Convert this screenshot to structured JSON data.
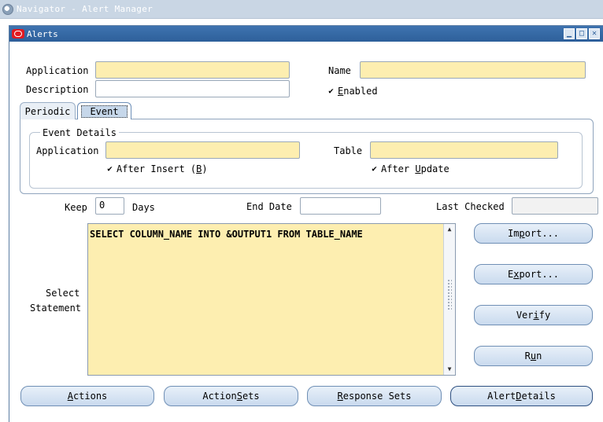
{
  "navigator": {
    "title": "Navigator - Alert Manager"
  },
  "window": {
    "title": "Alerts",
    "controls": {
      "minimize": "▁",
      "maximize": "□",
      "close": "✕"
    }
  },
  "form": {
    "application_label": "Application",
    "application_value": "",
    "name_label": "Name",
    "name_value": "",
    "description_label": "Description",
    "description_value": "",
    "enabled_label_pre": "",
    "enabled_hotkey": "E",
    "enabled_label_post": "nabled",
    "enabled_checked": "✔"
  },
  "tabs": [
    {
      "label": "Periodic"
    },
    {
      "label": "Event"
    }
  ],
  "event_details": {
    "legend": "Event Details",
    "application_label": "Application",
    "application_value": "",
    "table_label": "Table",
    "table_value": "",
    "after_insert_pre": "After Insert (",
    "after_insert_hotkey": "B",
    "after_insert_post": ")",
    "after_insert_checked": "✔",
    "after_update_pre": "After ",
    "after_update_hotkey": "U",
    "after_update_post": "pdate",
    "after_update_checked": "✔"
  },
  "keep": {
    "label": "Keep",
    "value": "0",
    "unit": "Days"
  },
  "end_date": {
    "label": "End Date",
    "value": ""
  },
  "last_checked": {
    "label": "Last Checked",
    "value": ""
  },
  "select_statement": {
    "label_line1": "Select",
    "label_line2": "Statement",
    "value": "SELECT COLUMN_NAME INTO &OUTPUT1 FROM TABLE_NAME"
  },
  "side_buttons": {
    "import_pre": "Im",
    "import_hot": "p",
    "import_post": "ort...",
    "export_pre": "E",
    "export_hot": "x",
    "export_post": "port...",
    "verify_pre": "Ver",
    "verify_hot": "i",
    "verify_post": "fy",
    "run_pre": "R",
    "run_hot": "u",
    "run_post": "n"
  },
  "bottom_buttons": {
    "actions_pre": "",
    "actions_hot": "A",
    "actions_post": "ctions",
    "action_sets_pre": "Action ",
    "action_sets_hot": "S",
    "action_sets_post": "ets",
    "response_sets_pre": "",
    "response_sets_hot": "R",
    "response_sets_post": "esponse Sets",
    "alert_details_pre": "Alert ",
    "alert_details_hot": "D",
    "alert_details_post": "etails"
  }
}
